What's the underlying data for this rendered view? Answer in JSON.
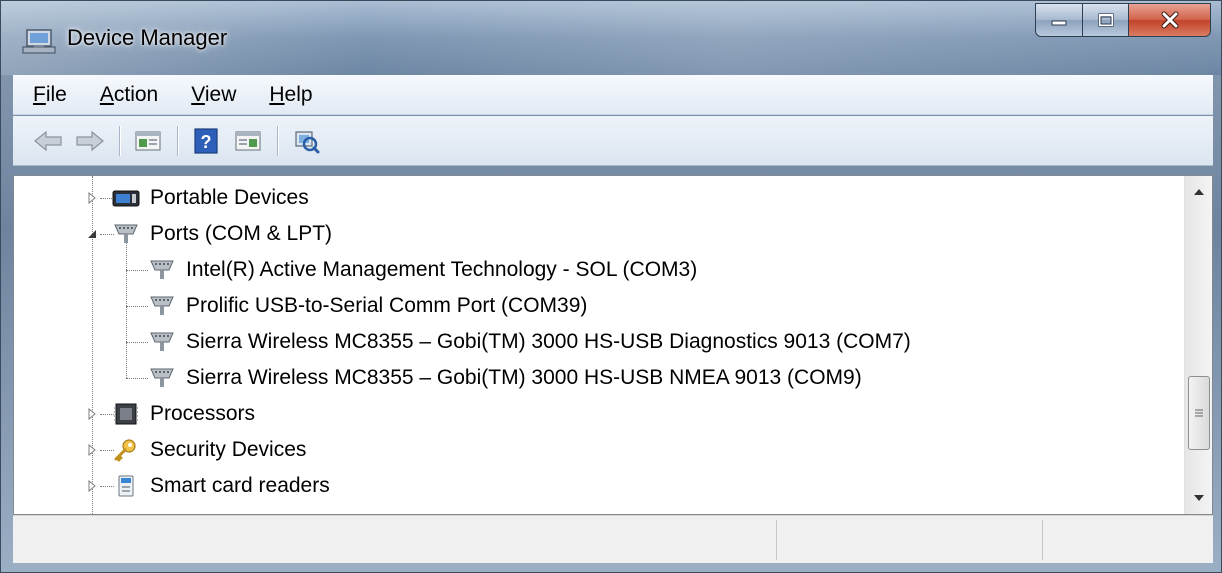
{
  "window": {
    "title": "Device Manager",
    "icon": "device-manager-icon"
  },
  "menu": {
    "items": [
      {
        "accel": "F",
        "rest": "ile"
      },
      {
        "accel": "A",
        "rest": "ction"
      },
      {
        "accel": "V",
        "rest": "iew"
      },
      {
        "accel": "H",
        "rest": "elp"
      }
    ]
  },
  "toolbar": {
    "buttons": [
      "back-icon",
      "forward-icon",
      "show-hide-console-tree-icon",
      "help-icon",
      "show-hide-action-pane-icon",
      "scan-hardware-changes-icon"
    ]
  },
  "tree": {
    "items": [
      {
        "label": "Portable Devices",
        "icon": "portable-devices-icon",
        "state": "collapsed",
        "level": 1
      },
      {
        "label": "Ports (COM & LPT)",
        "icon": "ports-icon",
        "state": "expanded",
        "level": 1
      },
      {
        "label": "Intel(R) Active Management Technology - SOL (COM3)",
        "icon": "port-icon",
        "level": 2
      },
      {
        "label": "Prolific USB-to-Serial Comm Port (COM39)",
        "icon": "port-icon",
        "level": 2
      },
      {
        "label": "Sierra Wireless MC8355 – Gobi(TM) 3000 HS-USB Diagnostics 9013 (COM7)",
        "icon": "port-icon",
        "level": 2
      },
      {
        "label": "Sierra Wireless MC8355 – Gobi(TM) 3000 HS-USB NMEA 9013 (COM9)",
        "icon": "port-icon",
        "level": 2
      },
      {
        "label": "Processors",
        "icon": "processor-icon",
        "state": "collapsed",
        "level": 1
      },
      {
        "label": "Security Devices",
        "icon": "security-devices-icon",
        "state": "collapsed",
        "level": 1
      },
      {
        "label": "Smart card readers",
        "icon": "smart-card-reader-icon",
        "state": "collapsed",
        "level": 1
      }
    ]
  },
  "colors": {
    "titlebar": "#7f97b3",
    "close_button": "#c2432a",
    "menubar": "#e2eaf4",
    "content_bg": "#ffffff"
  }
}
